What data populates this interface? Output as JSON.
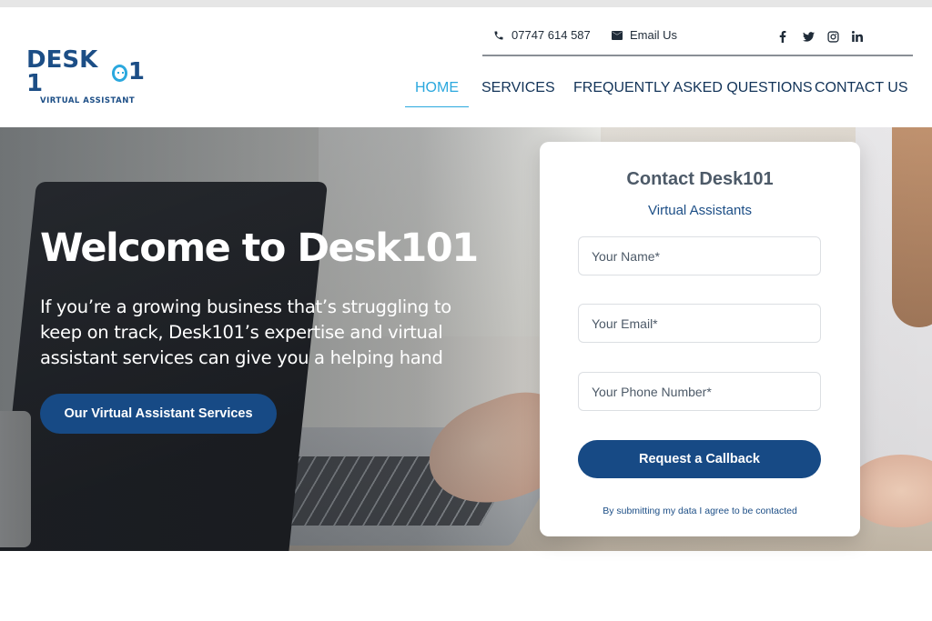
{
  "header": {
    "logo": {
      "word": "DESK 1",
      "word_end": "1",
      "subtitle": "VIRTUAL ASSISTANT"
    },
    "phone": "07747 614 587",
    "email_label": "Email Us",
    "social": [
      "facebook-icon",
      "twitter-icon",
      "instagram-icon",
      "linkedin-icon"
    ],
    "nav": [
      {
        "label": "HOME",
        "active": true
      },
      {
        "label": "SERVICES",
        "active": false
      },
      {
        "label": "FREQUENTLY ASKED QUESTIONS",
        "active": false
      },
      {
        "label": "CONTACT US",
        "active": false
      }
    ]
  },
  "hero": {
    "title": "Welcome to Desk101",
    "text": "If you’re a growing business that’s struggling to keep on track, Desk101’s expertise and virtual assistant services can give you a helping hand",
    "button": "Our Virtual Assistant Services"
  },
  "form": {
    "title": "Contact Desk101",
    "subtitle": "Virtual Assistants",
    "name_placeholder": "Your Name*",
    "email_placeholder": "Your Email*",
    "phone_placeholder": "Your Phone Number*",
    "submit": "Request a Callback",
    "consent": "By submitting my data I agree to be contacted"
  },
  "colors": {
    "brand": "#174a85",
    "accent": "#2ba8de",
    "text": "#123358"
  }
}
